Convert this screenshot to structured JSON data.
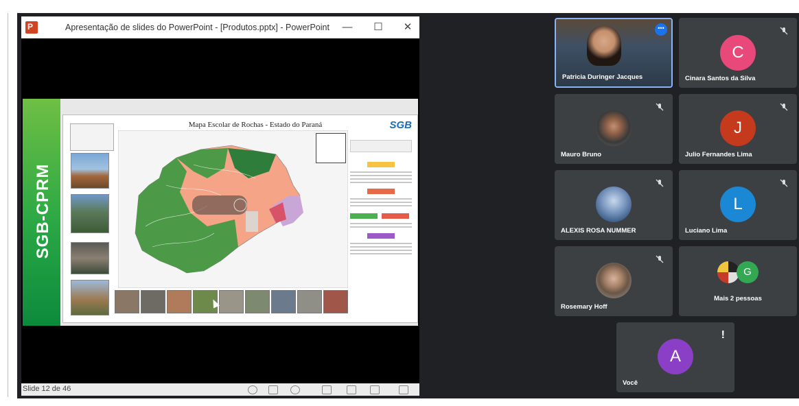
{
  "powerpoint": {
    "window_title": "Apresentação de slides do PowerPoint - [Produtos.pptx] - PowerPoint",
    "minimize_glyph": "—",
    "maximize_glyph": "☐",
    "close_glyph": "✕",
    "slide_side_text": "SGB-CPRM",
    "map_title": "Mapa Escolar de Rochas - Estado do Paraná",
    "logo_text": "SGB",
    "status_slide_counter": "Slide 12 de 46"
  },
  "participants": [
    {
      "name": "Patricia Duringer Jacques",
      "type": "video",
      "active": true,
      "more_glyph": "•••"
    },
    {
      "name": "Cinara Santos da Silva",
      "initial": "C",
      "color": "#e8497a",
      "muted": true
    },
    {
      "name": "Mauro Bruno",
      "type": "photo",
      "muted": true
    },
    {
      "name": "Julio Fernandes Lima",
      "initial": "J",
      "color": "#c5391d",
      "muted": true
    },
    {
      "name": "ALEXIS ROSA NUMMER",
      "type": "photo",
      "muted": true
    },
    {
      "name": "Luciano Lima",
      "initial": "L",
      "color": "#1a88d4",
      "muted": true
    },
    {
      "name": "Rosemary Hoff",
      "type": "photo",
      "muted": true
    },
    {
      "name": "Mais 2 pessoas",
      "initial": "G",
      "color": "#33a853"
    },
    {
      "name": "Você",
      "initial": "A",
      "color": "#8b3fc7",
      "alert_glyph": "!"
    }
  ],
  "colors": {
    "meet_background": "#202124",
    "tile_background": "#3c4043",
    "active_border": "#8ab4f8"
  }
}
